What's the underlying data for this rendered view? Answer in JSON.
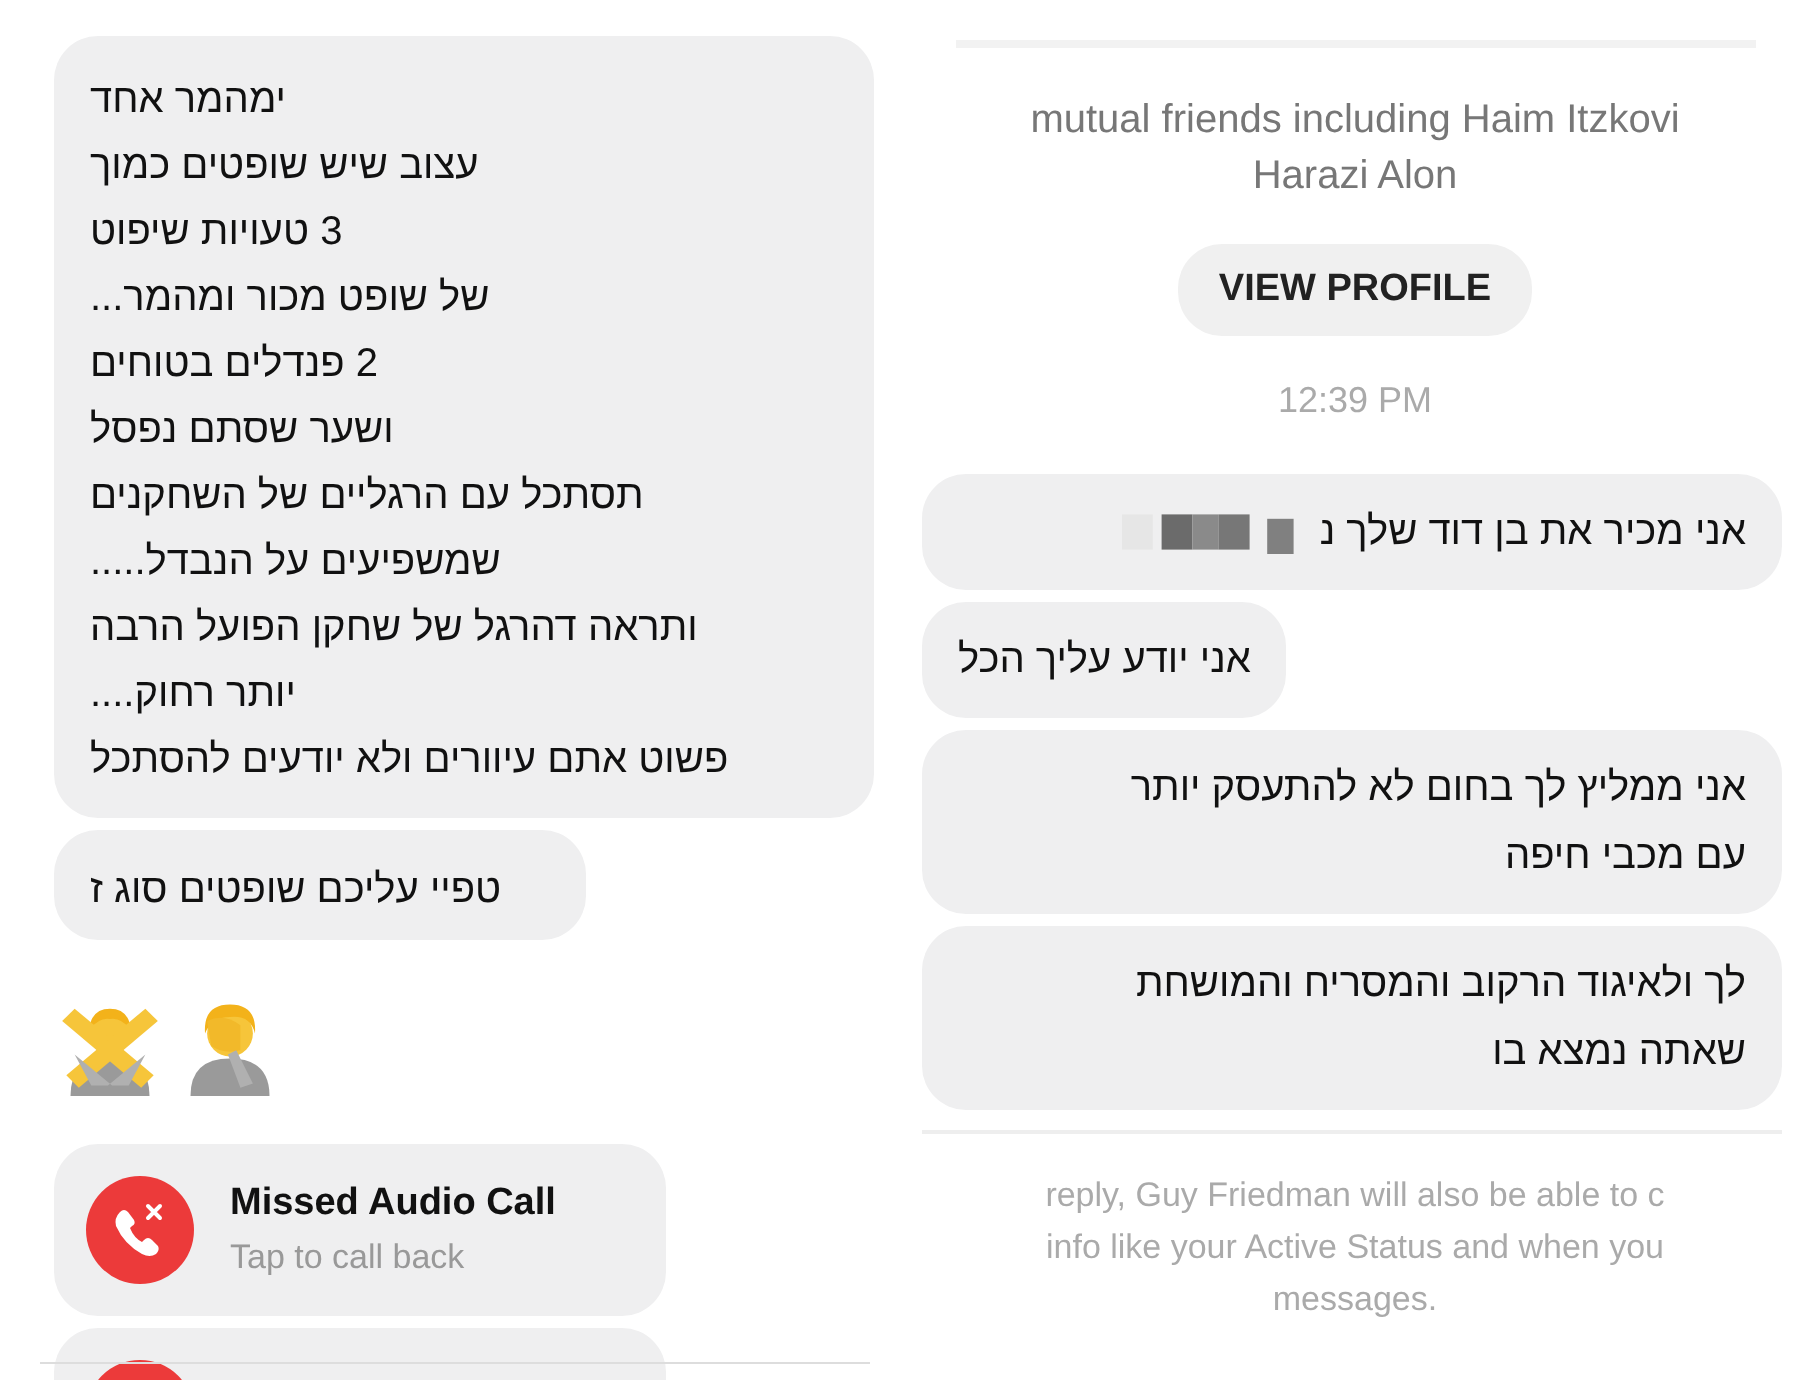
{
  "left_panel": {
    "messages": [
      {
        "kind": "text",
        "lines": [
          "ימהמר אחד",
          "עצוב שיש שופטים כמוך",
          "3 טעויות שיפוט",
          "של שופט מכור ומהמר...",
          "2 פנדלים בטוחים",
          "ושער שסתם נפסל",
          "תסתכל עם הרגליים של השחקנים",
          "שמשפיעים על הנבדל.....",
          "ותראה דהרגל של שחקן הפועל הרבה",
          "יותר רחוק....",
          "פשוט אתם עיוורים ולא יודעים להסתכל"
        ]
      },
      {
        "kind": "text",
        "lines": [
          "טפיי עליכם שופטים סוג ז"
        ]
      },
      {
        "kind": "emoji"
      },
      {
        "kind": "call",
        "title": "Missed Audio Call",
        "subtitle": "Tap to call back"
      },
      {
        "kind": "call_cut"
      }
    ]
  },
  "right_panel": {
    "intro": [
      "mutual friends including Haim Itzkovi",
      "Harazi Alon"
    ],
    "view_profile_button": "VIEW PROFILE",
    "time": "12:39 PM",
    "messages": [
      {
        "lines": [
          "אני מכיר את בן דוד שלך נ"
        ],
        "redacted": true
      },
      {
        "lines": [
          "אני יודע עליך הכל"
        ],
        "redacted": false
      },
      {
        "lines": [
          "אני ממליץ לך בחום לא להתעסק יותר",
          "עם מכבי חיפה"
        ],
        "redacted": false
      },
      {
        "lines": [
          "לך ולאיגוד הרקוב והמסריח והמושחת",
          "שאתה נמצא בו"
        ],
        "redacted": false
      }
    ],
    "footer": [
      "reply, Guy Friedman will also be able to c",
      "info like your Active Status and when you",
      "messages."
    ]
  }
}
